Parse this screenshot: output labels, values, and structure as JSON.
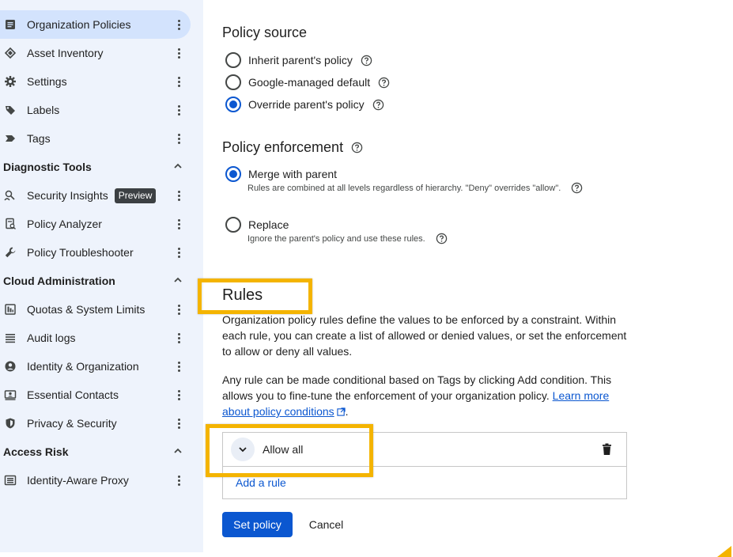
{
  "sidebar": {
    "items": [
      {
        "label": "Organization Policies",
        "icon": "policy-icon",
        "active": true
      },
      {
        "label": "Asset Inventory",
        "icon": "diamond-icon"
      },
      {
        "label": "Settings",
        "icon": "gear-icon"
      },
      {
        "label": "Labels",
        "icon": "label-icon"
      },
      {
        "label": "Tags",
        "icon": "tag-icon"
      },
      {
        "label": "Security Insights",
        "icon": "insights-icon",
        "badge": "Preview"
      },
      {
        "label": "Policy Analyzer",
        "icon": "analyzer-icon"
      },
      {
        "label": "Policy Troubleshooter",
        "icon": "wrench-icon"
      },
      {
        "label": "Quotas & System Limits",
        "icon": "quota-icon"
      },
      {
        "label": "Audit logs",
        "icon": "list-icon"
      },
      {
        "label": "Identity & Organization",
        "icon": "account-icon"
      },
      {
        "label": "Essential Contacts",
        "icon": "contacts-icon"
      },
      {
        "label": "Privacy & Security",
        "icon": "shield-icon"
      },
      {
        "label": "Identity-Aware Proxy",
        "icon": "proxy-icon"
      }
    ],
    "sections": [
      "Diagnostic Tools",
      "Cloud Administration",
      "Access Risk"
    ]
  },
  "policy_source": {
    "title": "Policy source",
    "options": [
      "Inherit parent's policy",
      "Google-managed default",
      "Override parent's policy"
    ],
    "selected": "Override parent's policy"
  },
  "policy_enforcement": {
    "title": "Policy enforcement",
    "merge_label": "Merge with parent",
    "merge_desc": "Rules are combined at all levels regardless of hierarchy. \"Deny\" overrides \"allow\".",
    "replace_label": "Replace",
    "replace_desc": "Ignore the parent's policy and use these rules.",
    "selected": "Merge with parent"
  },
  "rules": {
    "title": "Rules",
    "para1": "Organization policy rules define the values to be enforced by a constraint. Within each rule, you can create a list of allowed or denied values, or set the enforcement to allow or deny all values.",
    "para2_prefix": "Any rule can be made conditional based on Tags by clicking Add condition. This allows you to fine-tune the enforcement of your organization policy. ",
    "para2_link": "Learn more about policy conditions",
    "para2_suffix": ".",
    "rule_label": "Allow all",
    "add_rule": "Add a rule"
  },
  "actions": {
    "set_policy": "Set policy",
    "cancel": "Cancel"
  },
  "colors": {
    "accent": "#0b57d0",
    "highlight": "#f4b400",
    "sidebar_bg": "#eef3fc",
    "active_bg": "#d3e3fd"
  }
}
